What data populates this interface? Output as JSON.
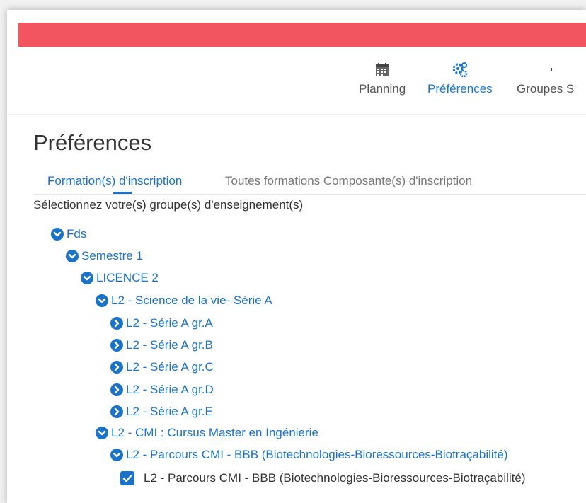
{
  "nav": {
    "items": [
      {
        "label": "Planning",
        "icon": "calendar-icon"
      },
      {
        "label": "Préférences",
        "icon": "gears-icon"
      },
      {
        "label": "Groupes S",
        "icon": "group-icon"
      }
    ],
    "active_color": "#1976d2"
  },
  "header_bar_color": "#f25560",
  "page_title": "Préférences",
  "tabs": [
    {
      "label": "Formation(s) d'inscription",
      "active": true
    },
    {
      "label": "Toutes formations Composante(s) d'inscription",
      "active": false
    }
  ],
  "instruction": "Sélectionnez votre(s) groupe(s) d'enseignement(s)",
  "tree": [
    {
      "label": "Fds",
      "state": "expanded"
    },
    {
      "label": "Semestre 1",
      "state": "expanded"
    },
    {
      "label": "LICENCE 2",
      "state": "expanded"
    },
    {
      "label": "L2 - Science de la vie- Série A",
      "state": "expanded"
    },
    {
      "label": "L2 - Série A gr.A",
      "state": "collapsed"
    },
    {
      "label": "L2 - Série A gr.B",
      "state": "collapsed"
    },
    {
      "label": "L2 - Série A gr.C",
      "state": "collapsed"
    },
    {
      "label": "L2 - Série A gr.D",
      "state": "collapsed"
    },
    {
      "label": "L2 - Série A gr.E",
      "state": "collapsed"
    },
    {
      "label": "L2 - CMI : Cursus Master en Ingénierie",
      "state": "expanded"
    },
    {
      "label": "L2 - Parcours CMI - BBB (Biotechnologies-Bioressources-Biotraçabilité)",
      "state": "expanded"
    }
  ],
  "checked_item": {
    "label": "L2 - Parcours CMI - BBB (Biotechnologies-Bioressources-Biotraçabilité)",
    "checked": true
  },
  "accent_color": "#1a73c8"
}
